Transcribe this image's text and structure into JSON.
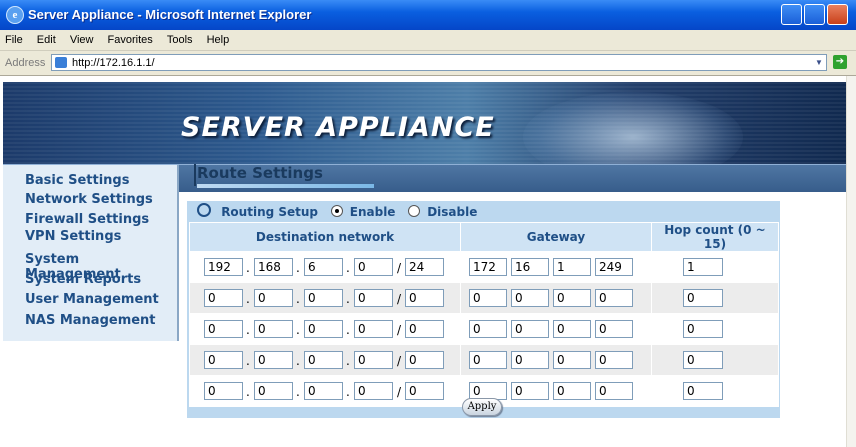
{
  "window": {
    "title": "Server Appliance - Microsoft Internet Explorer"
  },
  "menu": [
    "File",
    "Edit",
    "View",
    "Favorites",
    "Tools",
    "Help"
  ],
  "address": {
    "label": "Address",
    "url": "http://172.16.1.1/",
    "go": "Go"
  },
  "banner": {
    "title": "SERVER APPLIANCE"
  },
  "sidebar": {
    "items": [
      {
        "label": "Basic Settings"
      },
      {
        "label": "Network Settings"
      },
      {
        "label": "Firewall Settings"
      },
      {
        "label": "VPN Settings"
      },
      {
        "label": "System Management"
      },
      {
        "label": "System Reports"
      },
      {
        "label": "User Management"
      },
      {
        "label": "NAS Management"
      }
    ]
  },
  "page": {
    "title": "Route Settings"
  },
  "routing": {
    "label": "Routing Setup",
    "enable": "Enable",
    "disable": "Disable",
    "selected": "Enable"
  },
  "table": {
    "headers": {
      "dest": "Destination network",
      "gateway": "Gateway",
      "hop": "Hop count (0 ~ 15)"
    },
    "rows": [
      {
        "dest": [
          "192",
          "168",
          "6",
          "0"
        ],
        "prefix": "24",
        "gw": [
          "172",
          "16",
          "1",
          "249"
        ],
        "hop": "1"
      },
      {
        "dest": [
          "0",
          "0",
          "0",
          "0"
        ],
        "prefix": "0",
        "gw": [
          "0",
          "0",
          "0",
          "0"
        ],
        "hop": "0"
      },
      {
        "dest": [
          "0",
          "0",
          "0",
          "0"
        ],
        "prefix": "0",
        "gw": [
          "0",
          "0",
          "0",
          "0"
        ],
        "hop": "0"
      },
      {
        "dest": [
          "0",
          "0",
          "0",
          "0"
        ],
        "prefix": "0",
        "gw": [
          "0",
          "0",
          "0",
          "0"
        ],
        "hop": "0"
      },
      {
        "dest": [
          "0",
          "0",
          "0",
          "0"
        ],
        "prefix": "0",
        "gw": [
          "0",
          "0",
          "0",
          "0"
        ],
        "hop": "0"
      }
    ]
  },
  "apply_label": "Apply"
}
